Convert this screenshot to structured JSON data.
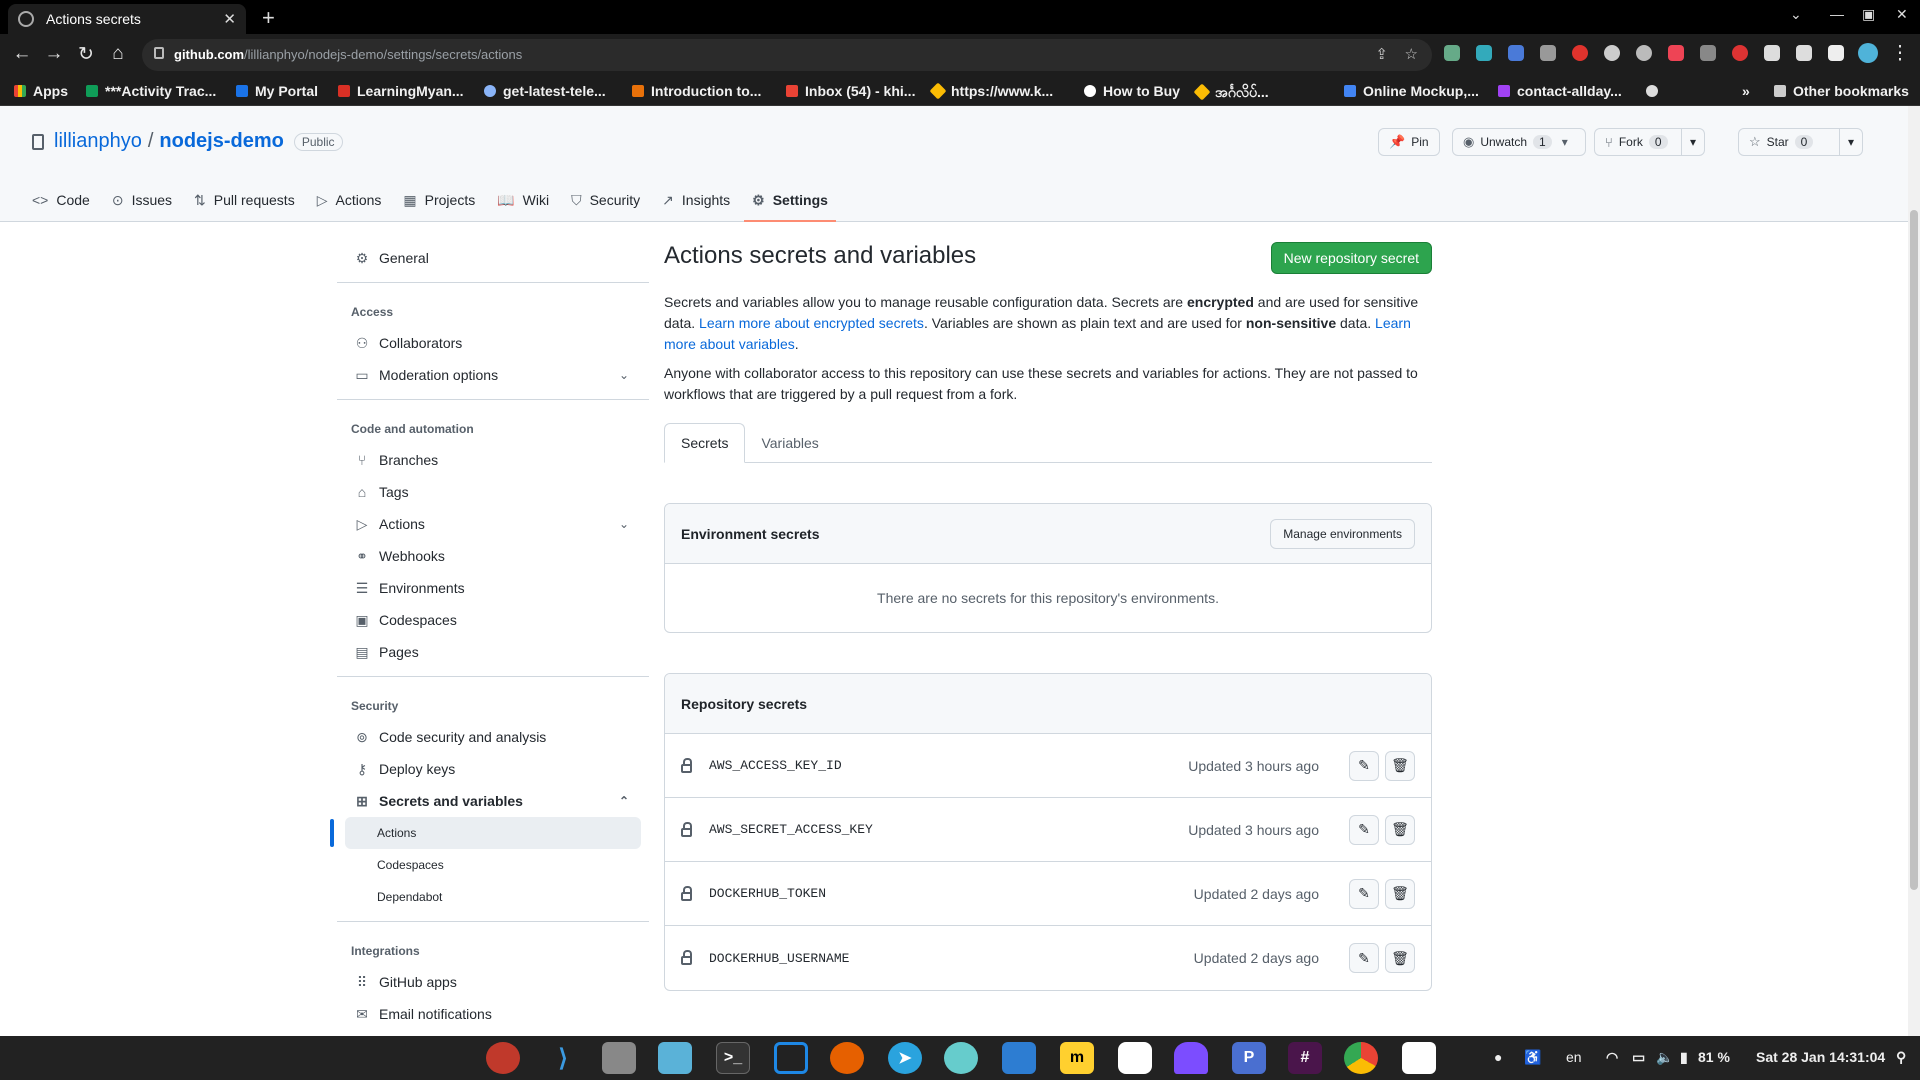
{
  "browser": {
    "tab_title": "Actions secrets",
    "url_host": "github.com",
    "url_path": "/lillianphyo/nodejs-demo/settings/secrets/actions",
    "bookmarks": [
      {
        "label": "Apps",
        "color": "#f4b400"
      },
      {
        "label": "***Activity Trac...",
        "color": "#0f9d58"
      },
      {
        "label": "My Portal",
        "color": "#1a73e8"
      },
      {
        "label": "LearningMyan...",
        "color": "#d93025"
      },
      {
        "label": "get-latest-tele...",
        "color": "#8ab4f8"
      },
      {
        "label": "Introduction to...",
        "color": "#e8710a"
      },
      {
        "label": "Inbox (54) - khi...",
        "color": "#ea4335"
      },
      {
        "label": "https://www.k...",
        "color": "#fbbc04"
      },
      {
        "label": "How to Buy",
        "color": "#ffffff"
      },
      {
        "label": "အင်္ဂလိပ်...",
        "color": "#fbbc04"
      },
      {
        "label": "Online Mockup,...",
        "color": "#4285f4"
      },
      {
        "label": "contact-allday...",
        "color": "#a142f4"
      }
    ],
    "other_bookmarks": "Other bookmarks"
  },
  "repo": {
    "owner": "lillianphyo",
    "separator": "/",
    "name": "nodejs-demo",
    "visibility": "Public",
    "pin_label": "Pin",
    "watch_label": "Unwatch",
    "watch_count": "1",
    "fork_label": "Fork",
    "fork_count": "0",
    "star_label": "Star",
    "star_count": "0"
  },
  "repo_nav": [
    {
      "label": "Code",
      "icon": "code-icon",
      "glyph": "<>"
    },
    {
      "label": "Issues",
      "icon": "issue-icon",
      "glyph": "⊙"
    },
    {
      "label": "Pull requests",
      "icon": "pull-request-icon",
      "glyph": "⇅"
    },
    {
      "label": "Actions",
      "icon": "play-icon",
      "glyph": "▷"
    },
    {
      "label": "Projects",
      "icon": "table-icon",
      "glyph": "▦"
    },
    {
      "label": "Wiki",
      "icon": "book-icon",
      "glyph": "📖"
    },
    {
      "label": "Security",
      "icon": "shield-icon",
      "glyph": "⛉"
    },
    {
      "label": "Insights",
      "icon": "graph-icon",
      "glyph": "↗"
    },
    {
      "label": "Settings",
      "icon": "gear-icon",
      "glyph": "⚙"
    }
  ],
  "sidebar": {
    "general": "General",
    "access_heading": "Access",
    "collaborators": "Collaborators",
    "moderation": "Moderation options",
    "code_heading": "Code and automation",
    "branches": "Branches",
    "tags": "Tags",
    "actions": "Actions",
    "webhooks": "Webhooks",
    "environments": "Environments",
    "codespaces": "Codespaces",
    "pages": "Pages",
    "security_heading": "Security",
    "code_security": "Code security and analysis",
    "deploy_keys": "Deploy keys",
    "secrets_vars": "Secrets and variables",
    "sub_actions": "Actions",
    "sub_codespaces": "Codespaces",
    "sub_dependabot": "Dependabot",
    "integrations_heading": "Integrations",
    "github_apps": "GitHub apps",
    "email_notifications": "Email notifications"
  },
  "main": {
    "title": "Actions secrets and variables",
    "new_secret_button": "New repository secret",
    "desc1_a": "Secrets and variables allow you to manage reusable configuration data. Secrets are ",
    "desc1_b": "encrypted",
    "desc1_c": " and are used for sensitive data. ",
    "desc1_link1": "Learn more about encrypted secrets",
    "desc1_d": ". Variables are shown as plain text and are used for ",
    "desc1_e": "non-sensitive",
    "desc1_f": " data. ",
    "desc1_link2": "Learn more about variables",
    "desc1_g": ".",
    "desc2": "Anyone with collaborator access to this repository can use these secrets and variables for actions. They are not passed to workflows that are triggered by a pull request from a fork.",
    "tabs": [
      "Secrets",
      "Variables"
    ],
    "env_secrets_title": "Environment secrets",
    "manage_env_button": "Manage environments",
    "env_empty": "There are no secrets for this repository's environments.",
    "repo_secrets_title": "Repository secrets",
    "secrets": [
      {
        "name": "AWS_ACCESS_KEY_ID",
        "updated": "Updated 3 hours ago"
      },
      {
        "name": "AWS_SECRET_ACCESS_KEY",
        "updated": "Updated 3 hours ago"
      },
      {
        "name": "DOCKERHUB_TOKEN",
        "updated": "Updated 2 days ago"
      },
      {
        "name": "DOCKERHUB_USERNAME",
        "updated": "Updated 2 days ago"
      }
    ]
  },
  "taskbar": {
    "language": "en",
    "battery": "81 %",
    "datetime": "Sat 28 Jan  14:31:04"
  }
}
